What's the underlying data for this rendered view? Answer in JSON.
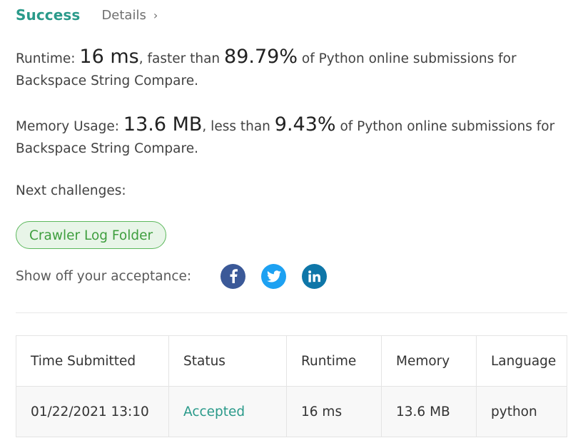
{
  "header": {
    "status": "Success",
    "details_label": "Details",
    "details_chevron": "›"
  },
  "runtime": {
    "label": "Runtime:",
    "value": "16 ms",
    "comparison": ", faster than",
    "percent": "89.79%",
    "suffix": "of Python online submissions for Backspace String Compare."
  },
  "memory": {
    "label": "Memory Usage:",
    "value": "13.6 MB",
    "comparison": ", less than",
    "percent": "9.43%",
    "suffix": "of Python online submissions for Backspace String Compare."
  },
  "next": {
    "label": "Next challenges:",
    "challenge": "Crawler Log Folder"
  },
  "share": {
    "label": "Show off your acceptance:",
    "icons": [
      "facebook-icon",
      "twitter-icon",
      "linkedin-icon"
    ],
    "colors": {
      "facebook": "#3b5998",
      "twitter": "#1da1f2",
      "linkedin": "#0e76a8"
    }
  },
  "table": {
    "headers": [
      "Time Submitted",
      "Status",
      "Runtime",
      "Memory",
      "Language"
    ],
    "rows": [
      [
        "01/22/2021 13:10",
        "Accepted",
        "16 ms",
        "13.6 MB",
        "python"
      ]
    ]
  },
  "colors": {
    "accent": "#2a9a8a",
    "challenge_border": "#5cb85c",
    "challenge_bg": "#e8f5e8"
  }
}
